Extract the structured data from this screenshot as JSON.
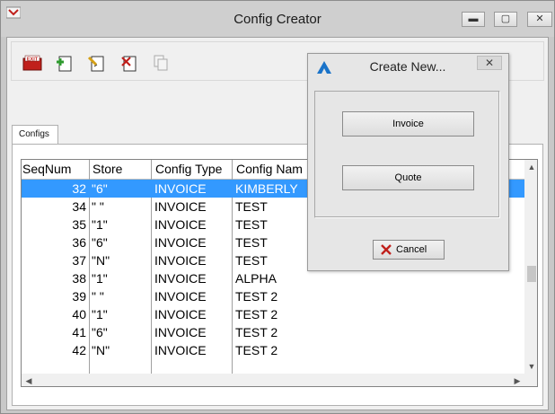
{
  "window": {
    "title": "Config Creator",
    "min_label": "▬",
    "max_label": "▢",
    "close_label": "✕"
  },
  "toolbar": {
    "exit_label": "EXIT",
    "icons": [
      "exit-icon",
      "add-icon",
      "edit-icon",
      "delete-icon",
      "copy-icon"
    ]
  },
  "tabs": [
    {
      "label": "Configs"
    }
  ],
  "grid": {
    "columns": [
      "SeqNum",
      "Store",
      "Config Type",
      "Config Nam"
    ],
    "rows": [
      {
        "seq": "32",
        "store": "\"6\"",
        "type": "INVOICE",
        "name": "KIMBERLY",
        "selected": true
      },
      {
        "seq": "34",
        "store": "\" \"",
        "type": "INVOICE",
        "name": "TEST"
      },
      {
        "seq": "35",
        "store": "\"1\"",
        "type": "INVOICE",
        "name": "TEST"
      },
      {
        "seq": "36",
        "store": "\"6\"",
        "type": "INVOICE",
        "name": "TEST"
      },
      {
        "seq": "37",
        "store": "\"N\"",
        "type": "INVOICE",
        "name": "TEST"
      },
      {
        "seq": "38",
        "store": "\"1\"",
        "type": "INVOICE",
        "name": "ALPHA"
      },
      {
        "seq": "39",
        "store": "\" \"",
        "type": "INVOICE",
        "name": "TEST 2"
      },
      {
        "seq": "40",
        "store": "\"1\"",
        "type": "INVOICE",
        "name": "TEST 2"
      },
      {
        "seq": "41",
        "store": "\"6\"",
        "type": "INVOICE",
        "name": "TEST 2"
      },
      {
        "seq": "42",
        "store": "\"N\"",
        "type": "INVOICE",
        "name": "TEST 2"
      }
    ]
  },
  "dialog": {
    "title": "Create New...",
    "close_label": "✕",
    "invoice_label": "Invoice",
    "quote_label": "Quote",
    "cancel_label": "Cancel"
  },
  "colors": {
    "selection": "#3399ff",
    "exit_red": "#c0201c",
    "add_green": "#2e9a2e",
    "dialog_icon_blue": "#1a73c9"
  }
}
